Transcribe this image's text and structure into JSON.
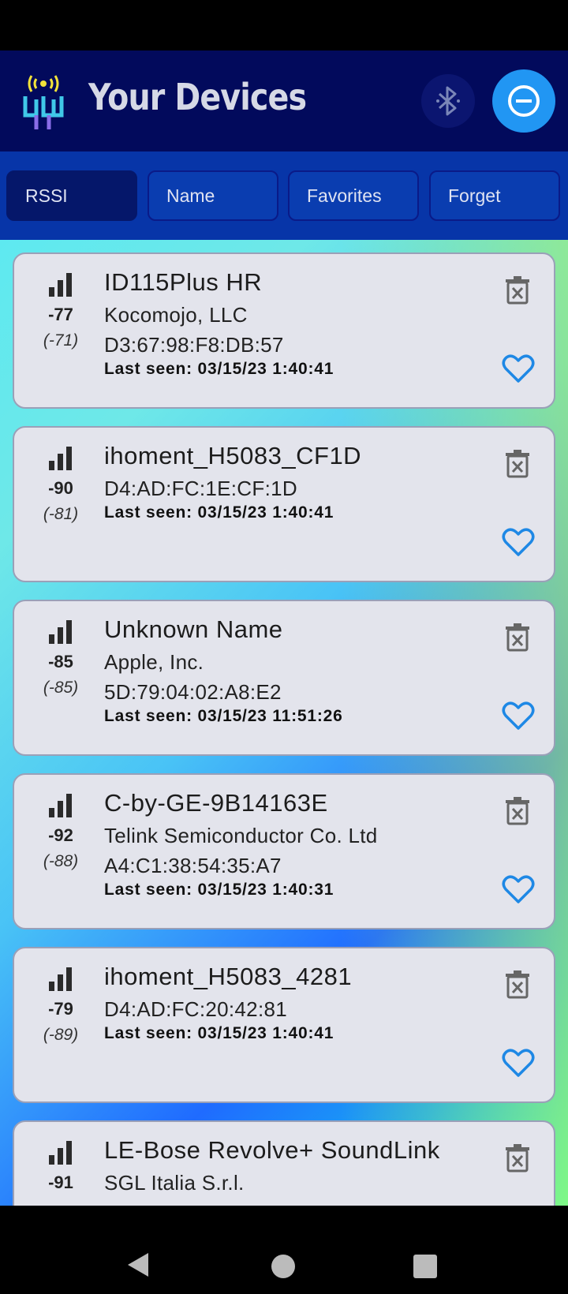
{
  "header": {
    "title": "Your Devices",
    "accent_color": "#2196f3",
    "bar_color": "#020a5c"
  },
  "filters": [
    {
      "label": "RSSI",
      "active": true
    },
    {
      "label": "Name",
      "active": false
    },
    {
      "label": "Favorites",
      "active": false
    },
    {
      "label": "Forget",
      "active": false
    }
  ],
  "devices": [
    {
      "rssi": "-77",
      "rssi_avg": "(-71)",
      "name": "ID115Plus HR",
      "manufacturer": "Kocomojo, LLC",
      "address": "D3:67:98:F8:DB:57",
      "last_seen": "Last seen: 03/15/23 1:40:41"
    },
    {
      "rssi": "-90",
      "rssi_avg": "(-81)",
      "name": "ihoment_H5083_CF1D",
      "manufacturer": "",
      "address": "D4:AD:FC:1E:CF:1D",
      "last_seen": "Last seen: 03/15/23 1:40:41"
    },
    {
      "rssi": "-85",
      "rssi_avg": "(-85)",
      "name": "Unknown Name",
      "manufacturer": "Apple, Inc.",
      "address": "5D:79:04:02:A8:E2",
      "last_seen": "Last seen: 03/15/23 11:51:26"
    },
    {
      "rssi": "-92",
      "rssi_avg": "(-88)",
      "name": "C-by-GE-9B14163E",
      "manufacturer": "Telink Semiconductor Co. Ltd",
      "address": "A4:C1:38:54:35:A7",
      "last_seen": "Last seen: 03/15/23 1:40:31"
    },
    {
      "rssi": "-79",
      "rssi_avg": "(-89)",
      "name": "ihoment_H5083_4281",
      "manufacturer": "",
      "address": "D4:AD:FC:20:42:81",
      "last_seen": "Last seen: 03/15/23 1:40:41"
    },
    {
      "rssi": "-91",
      "rssi_avg": "",
      "name": "LE-Bose Revolve+ SoundLink",
      "manufacturer": "SGL Italia S.r.l.",
      "address": "",
      "last_seen": ""
    }
  ],
  "icons": {
    "logo": "antenna-logo-icon",
    "bluetooth": "bluetooth-icon",
    "remove": "minus-circle-icon",
    "signal": "signal-bars-icon",
    "trash": "trash-icon",
    "favorite": "heart-outline-icon"
  }
}
